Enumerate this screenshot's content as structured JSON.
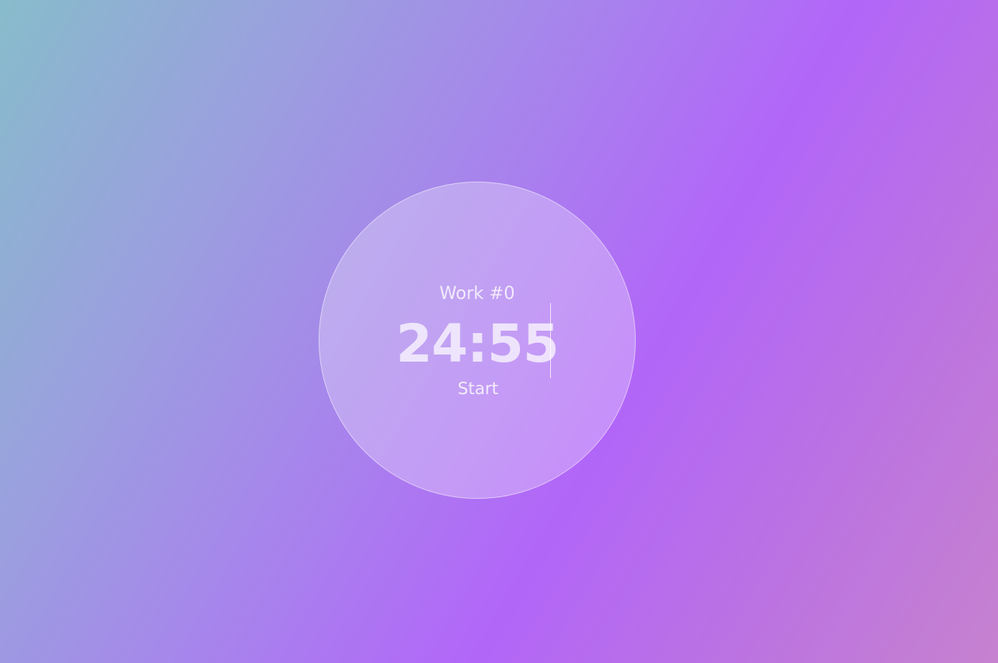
{
  "timer": {
    "session_label": "Work #0",
    "time": "24:55",
    "start_label": "Start"
  }
}
